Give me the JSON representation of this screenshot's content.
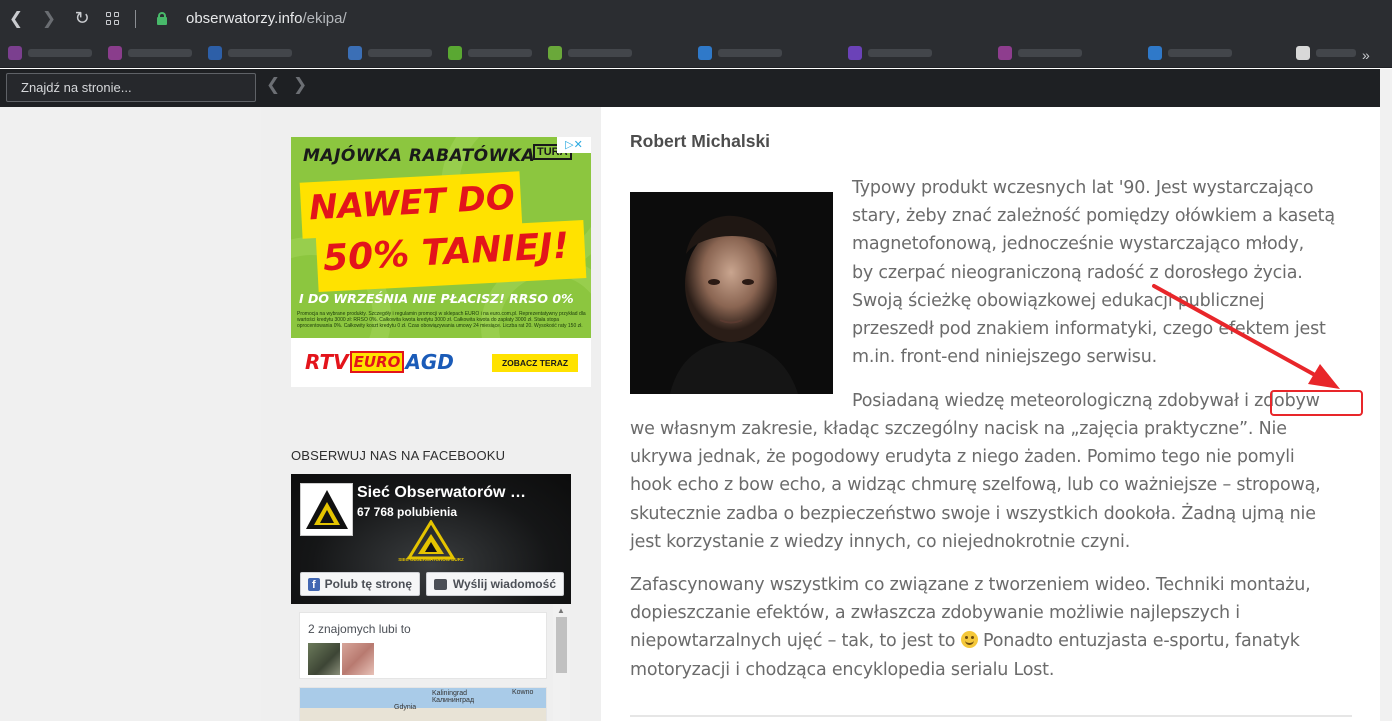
{
  "browser": {
    "url_domain": "obserwatorzy.info",
    "url_path": "/ekipa/",
    "find_placeholder": "Znajdź na stronie..."
  },
  "sidebar": {
    "ad": {
      "headline": "MAJÓWKA RABATÓWKA",
      "badge": "TURA",
      "line1": "NAWET DO",
      "line2": "50% TANIEJ!",
      "subline": "I DO WRZEŚNIA NIE PŁACISZ!  RRSO 0%",
      "fine_print": "Promocja na wybrane produkty. Szczegóły i regulamin promocji w sklepach EURO i na euro.com.pl. Reprezentatywny przykład dla wartości kredytu 3000 zł: RRSO 0%. Całkowita kwota kredytu 3000 zł. Całkowita kwota do zapłaty 3000 zł. Stała stopa oprocentowania 0%. Całkowity koszt kredytu 0 zł. Czas obowiązywania umowy 24 miesiące. Liczba rat 20. Wysokość raty 150 zł.",
      "logo_rtv": "RTV",
      "logo_euro": "EURO",
      "logo_agd": "AGD",
      "cta": "ZOBACZ TERAZ"
    },
    "facebook": {
      "heading": "OBSERWUJ NAS NA FACEBOOKU",
      "page_name": "Sieć Obserwatorów …",
      "likes": "67 768 polubienia",
      "emblem_text": "SIEĆ OBSERWATORÓW BURZ",
      "like_button": "Polub tę stronę",
      "message_button": "Wyślij wiadomość",
      "friends_text": "2 znajomych lubi to",
      "map_labels": [
        "Kaliningrad",
        "Калининград",
        "Kowno",
        "Gdynia"
      ]
    }
  },
  "article": {
    "author": "Robert Michalski",
    "p1_lines": [
      "Typowy produkt wczesnych lat '90. Jest wystarczająco",
      "stary, żeby znać zależność pomiędzy ołówkiem a kasetą",
      "magnetofonową, jednocześnie wystarczająco młody,",
      "by czerpać nieograniczoną radość z dorosłego życia.",
      "Swoją ścieżkę obowiązkowej edukacji publicznej",
      "przeszedł pod znakiem informatyki, czego efektem jest",
      "m.in. front-end niniejszego serwisu."
    ],
    "p2_first": "Posiadaną wiedzę meteorologiczną zdobywał i zdobyw",
    "p2_lines": [
      "we własnym zakresie, kładąc szczególny nacisk na „zajęcia praktyczne”. Nie",
      "ukrywa jednak, że pogodowy erudyta z niego żaden. Pomimo tego nie pomyli",
      "hook echo z bow echo, a widząc chmurę szelfową, lub co ważniejsze – stropową,",
      "skutecznie zadba o bezpieczeństwo swoje i wszystkich dookoła. Żadną ujmą nie",
      "jest korzystanie z wiedzy innych, co niejednokrotnie czyni."
    ],
    "p3_lines": [
      "Zafascynowany wszystkim co związane z tworzeniem wideo. Techniki montażu,",
      "dopieszczanie efektów, a zwłaszcza zdobywanie możliwie najlepszych i",
      "niepowtarzalnych ujęć – tak, to jest to",
      "Ponadto entuzjasta e-sportu, fanatyk",
      "motoryzacji i chodząca encyklopedia serialu Lost."
    ]
  },
  "colors": {
    "annotation": "#e8262a",
    "chrome": "#2b2d31",
    "text": "#6b6b6b"
  }
}
